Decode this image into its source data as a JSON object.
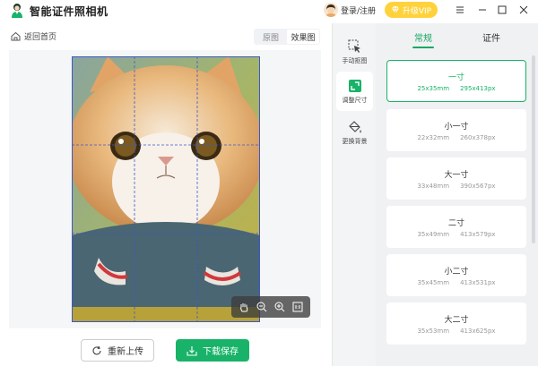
{
  "app": {
    "title": "智能证件照相机"
  },
  "header": {
    "login": "登录/注册",
    "vip": "升级VIP"
  },
  "toolbar": {
    "back": "返回首页",
    "original": "原图",
    "result": "效果图"
  },
  "sidebar": [
    {
      "label": "手动抠图",
      "icon": "cursor-select-icon",
      "active": false
    },
    {
      "label": "调整尺寸",
      "icon": "resize-icon",
      "active": true
    },
    {
      "label": "更换背景",
      "icon": "paint-bucket-icon",
      "active": false
    }
  ],
  "tabs": {
    "common": "常规",
    "cert": "证件"
  },
  "sizes": [
    {
      "name": "一寸",
      "mm": "25x35mm",
      "px": "295x413px",
      "selected": true
    },
    {
      "name": "小一寸",
      "mm": "22x32mm",
      "px": "260x378px",
      "selected": false
    },
    {
      "name": "大一寸",
      "mm": "33x48mm",
      "px": "390x567px",
      "selected": false
    },
    {
      "name": "二寸",
      "mm": "35x49mm",
      "px": "413x579px",
      "selected": false
    },
    {
      "name": "小二寸",
      "mm": "35x45mm",
      "px": "413x531px",
      "selected": false
    },
    {
      "name": "大二寸",
      "mm": "35x53mm",
      "px": "413x625px",
      "selected": false
    }
  ],
  "actions": {
    "reupload": "重新上传",
    "download": "下载保存"
  },
  "colors": {
    "accent": "#18b368",
    "vip": "#ffd23c"
  }
}
